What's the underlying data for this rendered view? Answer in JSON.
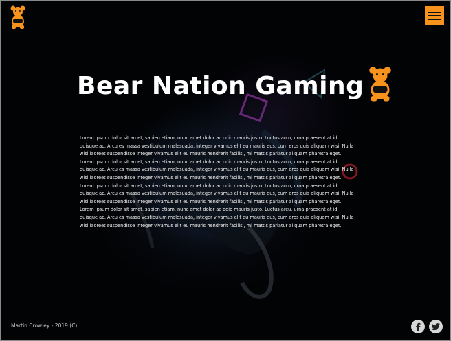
{
  "header": {
    "logo_icon": "bear-gamepad-icon",
    "menu_icon": "hamburger-menu-icon"
  },
  "hero": {
    "title": "Bear Nation Gaming",
    "title_icon": "bear-gamepad-icon"
  },
  "main": {
    "paragraphs": [
      "Lorem ipsum dolor sit amet, sapien etiam, nunc amet dolor ac odio mauris justo. Luctus arcu, urna praesent at id quisque ac. Arcu es massa vestibulum malesuada, integer vivamus elit eu mauris eus, cum eros quis aliquam wisi. Nulla wisi laoreet suspendisse integer vivamus elit eu mauris hendrerit facilisi, mi mattis pariatur aliquam pharetra eget.",
      "Lorem ipsum dolor sit amet, sapien etiam, nunc amet dolor ac odio mauris justo. Luctus arcu, urna praesent at id quisque ac. Arcu es massa vestibulum malesuada, integer vivamus elit eu mauris eus, cum eros quis aliquam wisi. Nulla wisi laoreet suspendisse integer vivamus elit eu mauris hendrerit facilisi, mi mattis pariatur aliquam pharetra eget.",
      "Lorem ipsum dolor sit amet, sapien etiam, nunc amet dolor ac odio mauris justo. Luctus arcu, urna praesent at id quisque ac. Arcu es massa vestibulum malesuada, integer vivamus elit eu mauris eus, cum eros quis aliquam wisi. Nulla wisi laoreet suspendisse integer vivamus elit eu mauris hendrerit facilisi, mi mattis pariatur aliquam pharetra eget.",
      "Lorem ipsum dolor sit amet, sapien etiam, nunc amet dolor ac odio mauris justo. Luctus arcu, urna praesent at id quisque ac. Arcu es massa vestibulum malesuada, integer vivamus elit eu mauris eus, cum eros quis aliquam wisi. Nulla wisi laoreet suspendisse integer vivamus elit eu mauris hendrerit facilisi, mi mattis pariatur aliquam pharetra eget."
    ]
  },
  "footer": {
    "credit": "Martin Crowley - 2019 (C)",
    "social": [
      {
        "icon": "facebook-icon"
      },
      {
        "icon": "twitter-icon"
      }
    ]
  },
  "colors": {
    "accent": "#f7931d",
    "background": "#000000",
    "text": "#ffffff"
  }
}
